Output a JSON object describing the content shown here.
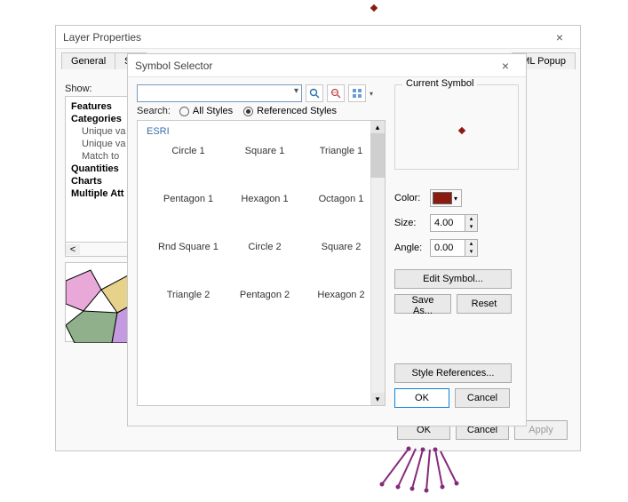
{
  "layer_dialog": {
    "title": "Layer Properties",
    "tabs": [
      "General",
      "So",
      "ML Popup"
    ],
    "show_label": "Show:",
    "tree": [
      {
        "label": "Features",
        "bold": true
      },
      {
        "label": "Categories",
        "bold": true
      },
      {
        "label": "Unique va",
        "indent": true
      },
      {
        "label": "Unique va",
        "indent": true
      },
      {
        "label": "Match to",
        "indent": true
      },
      {
        "label": "Quantities",
        "bold": true
      },
      {
        "label": "Charts",
        "bold": true
      },
      {
        "label": "Multiple Att",
        "bold": true
      }
    ],
    "hscroll_left": "<",
    "buttons": {
      "ok": "OK",
      "cancel": "Cancel",
      "apply": "Apply"
    }
  },
  "symbol_dialog": {
    "title": "Symbol Selector",
    "search_value": "",
    "search_label": "Search:",
    "radio_all": "All Styles",
    "radio_ref": "Referenced Styles",
    "radio_selected": "ref",
    "category": "ESRI",
    "symbols": [
      "Circle 1",
      "Square 1",
      "Triangle 1",
      "Pentagon 1",
      "Hexagon 1",
      "Octagon 1",
      "Rnd Square 1",
      "Circle 2",
      "Square 2",
      "Triangle 2",
      "Pentagon 2",
      "Hexagon 2"
    ],
    "current_symbol_label": "Current Symbol",
    "color_label": "Color:",
    "color_value": "#8c1b0f",
    "size_label": "Size:",
    "size_value": "4.00",
    "angle_label": "Angle:",
    "angle_value": "0.00",
    "edit_symbol": "Edit Symbol...",
    "save_as": "Save As...",
    "reset": "Reset",
    "style_refs": "Style References...",
    "ok": "OK",
    "cancel": "Cancel",
    "icons": {
      "search": "search-icon",
      "globe": "globe-search-icon",
      "grid": "view-grid-icon",
      "menu": "menu-caret-icon"
    }
  }
}
